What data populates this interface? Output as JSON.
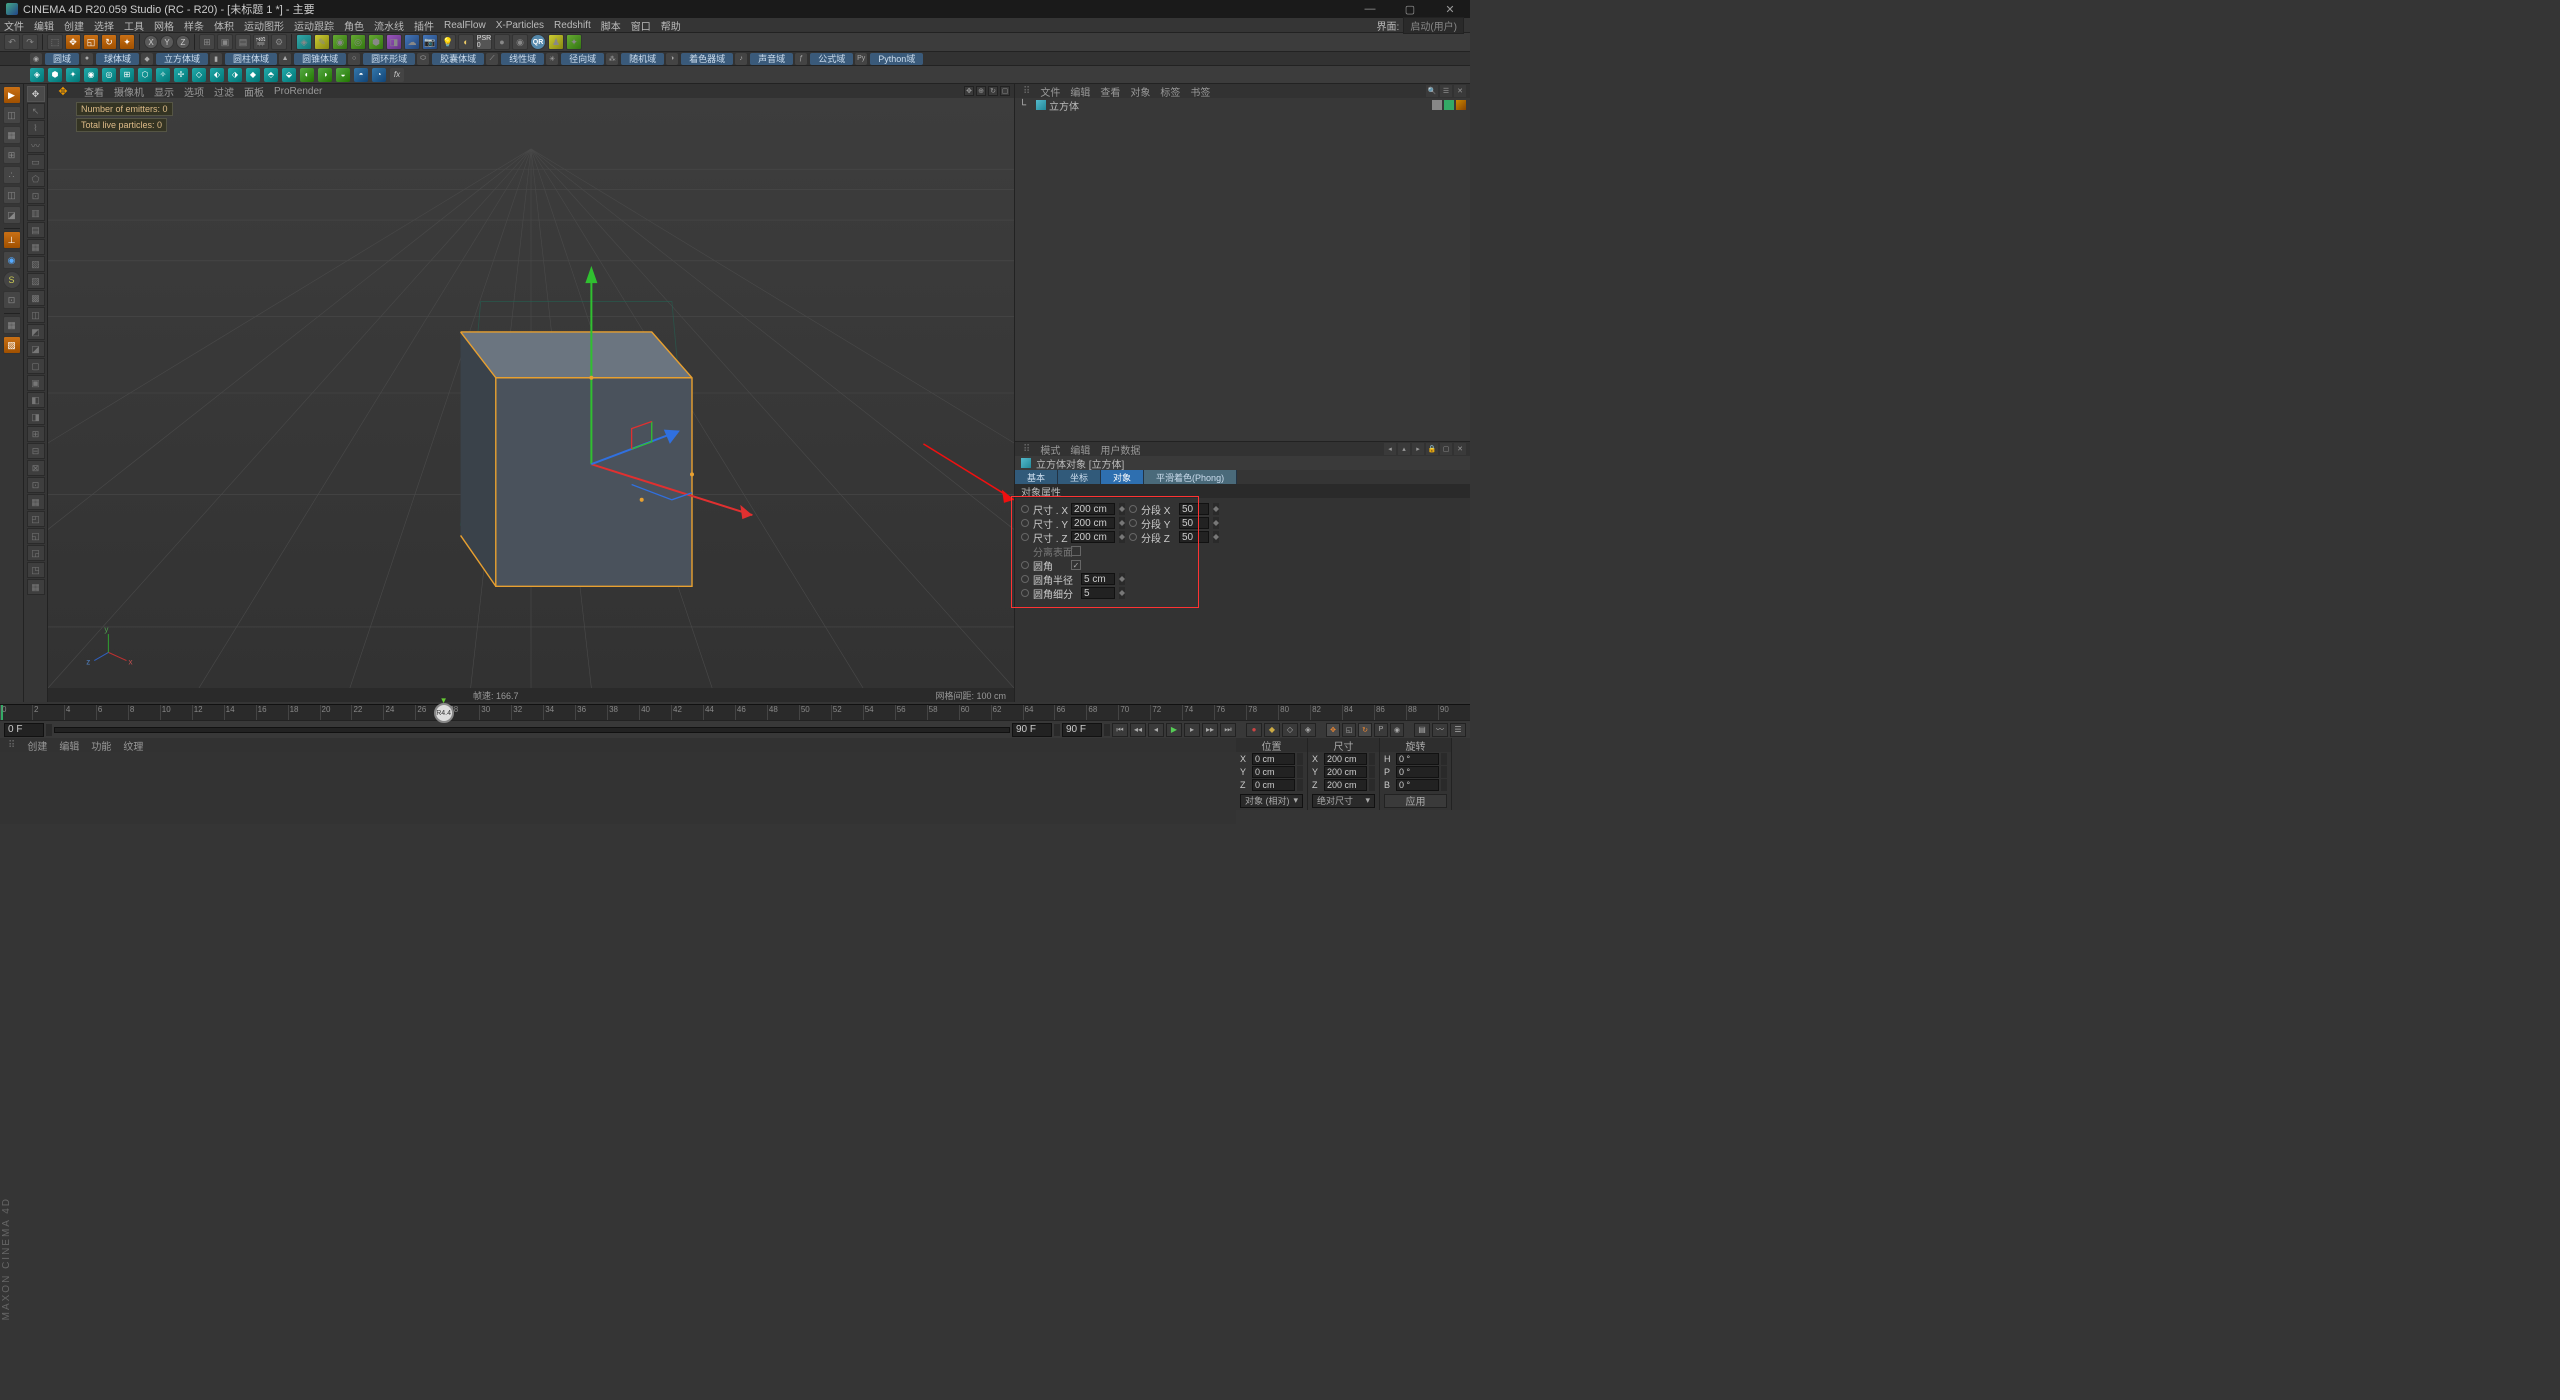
{
  "title": "CINEMA 4D R20.059 Studio (RC - R20) - [未标题 1 *] - 主要",
  "menus": [
    "文件",
    "编辑",
    "创建",
    "选择",
    "工具",
    "网格",
    "样条",
    "体积",
    "运动图形",
    "运动跟踪",
    "角色",
    "流水线",
    "插件",
    "RealFlow",
    "X-Particles",
    "Redshift",
    "脚本",
    "窗口",
    "帮助"
  ],
  "layout_label": "界面:",
  "layout_value": "启动(用户)",
  "fields": [
    "圆域",
    "球体域",
    "立方体域",
    "圆柱体域",
    "圆锥体域",
    "圆环形域",
    "胶囊体域",
    "线性域",
    "径向域",
    "随机域",
    "着色器域",
    "声音域",
    "公式域",
    "Python域"
  ],
  "vp_menus": [
    "查看",
    "摄像机",
    "显示",
    "选项",
    "过滤",
    "面板",
    "ProRender"
  ],
  "vp_stat1": "Number of emitters: 0",
  "vp_stat2": "Total live particles: 0",
  "vp_fps": "帧速: 166.7",
  "vp_grid": "网格间距: 100 cm",
  "om_menus": [
    "文件",
    "编辑",
    "查看",
    "对象",
    "标签",
    "书签"
  ],
  "obj_name": "立方体",
  "attr_menus": [
    "模式",
    "编辑",
    "用户数据"
  ],
  "attr_title": "立方体对象 [立方体]",
  "attr_tabs": {
    "basic": "基本",
    "coord": "坐标",
    "object": "对象",
    "phong": "平滑着色(Phong)"
  },
  "attr_sec": "对象属性",
  "attr": {
    "size_x_l": "尺寸 . X",
    "size_x": "200 cm",
    "seg_x_l": "分段 X",
    "seg_x": "50",
    "size_y_l": "尺寸 . Y",
    "size_y": "200 cm",
    "seg_y_l": "分段 Y",
    "seg_y": "50",
    "size_z_l": "尺寸 . Z",
    "size_z": "200 cm",
    "seg_z_l": "分段 Z",
    "seg_z": "50",
    "sep_l": "分离表面",
    "fillet_l": "圆角",
    "fillet_r_l": "圆角半径",
    "fillet_r": "5 cm",
    "fillet_s_l": "圆角细分",
    "fillet_s": "5"
  },
  "timeline": {
    "start": "0 F",
    "end": "90 F",
    "end2": "90 F",
    "head": "R4.4"
  },
  "bmenus": [
    "创建",
    "编辑",
    "功能",
    "纹理"
  ],
  "coords": {
    "pos": "位置",
    "size": "尺寸",
    "rot": "旋转",
    "px": "0 cm",
    "py": "0 cm",
    "pz": "0 cm",
    "sx": "200 cm",
    "sy": "200 cm",
    "sz": "200 cm",
    "rh": "0 °",
    "rp": "0 °",
    "rb": "0 °",
    "dd1": "对象 (相对)",
    "dd2": "绝对尺寸",
    "apply": "应用"
  },
  "brand": "MAXON CINEMA 4D"
}
